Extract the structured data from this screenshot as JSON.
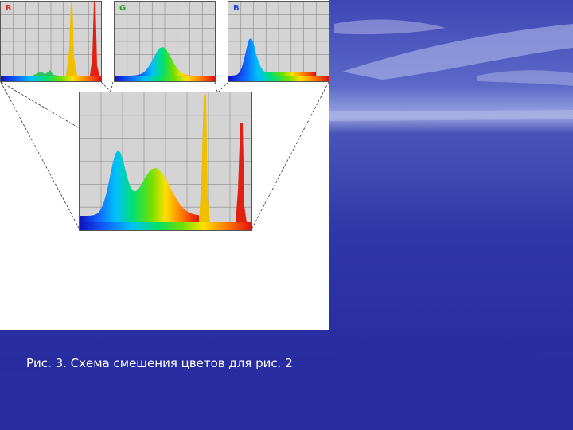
{
  "slide": {
    "caption": "Рис. 3. Схема смешения цветов для рис. 2"
  },
  "histograms": {
    "r": {
      "label": "R",
      "label_color": "#e03020"
    },
    "g": {
      "label": "G",
      "label_color": "#20a020"
    },
    "b": {
      "label": "B",
      "label_color": "#2040e0"
    }
  },
  "colors": {
    "sky_light": "#7f8fd6",
    "sea_deep": "#23279a",
    "panel_bg": "#d4d4d4",
    "figure_bg": "#ffffff"
  }
}
